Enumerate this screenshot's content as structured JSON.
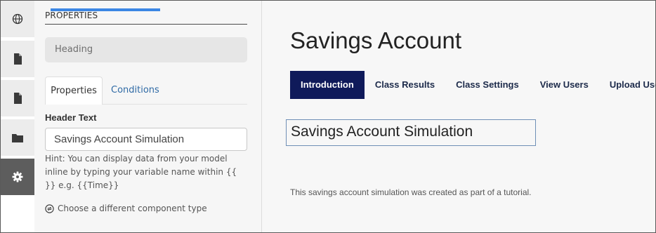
{
  "rail": {
    "icons": [
      "globe-icon",
      "document-icon",
      "document-icon",
      "folder-icon",
      "gear-icon"
    ],
    "active": "gear-icon"
  },
  "panel": {
    "title": "PROPERTIES",
    "component_name": "Heading",
    "tabs": [
      {
        "label": "Properties",
        "active": true
      },
      {
        "label": "Conditions",
        "active": false
      }
    ],
    "field_label": "Header Text",
    "field_value": "Savings Account Simulation",
    "hint": "Hint: You can display data from your model inline by typing your variable name within {{ }} e.g. {{Time}}",
    "change_type_label": "Choose a different component type"
  },
  "preview": {
    "title": "Savings Account",
    "nav": [
      {
        "label": "Introduction",
        "active": true
      },
      {
        "label": "Class Results",
        "active": false
      },
      {
        "label": "Class Settings",
        "active": false
      },
      {
        "label": "View Users",
        "active": false
      },
      {
        "label": "Upload Users",
        "active": false
      }
    ],
    "heading": "Savings Account Simulation",
    "body": "This savings account simulation was created as part of a tutorial."
  },
  "colors": {
    "accent_blue": "#3b86e4",
    "nav_active": "#0f1a5a",
    "link": "#2f6aa5",
    "rail_active": "#5d5d5d"
  }
}
